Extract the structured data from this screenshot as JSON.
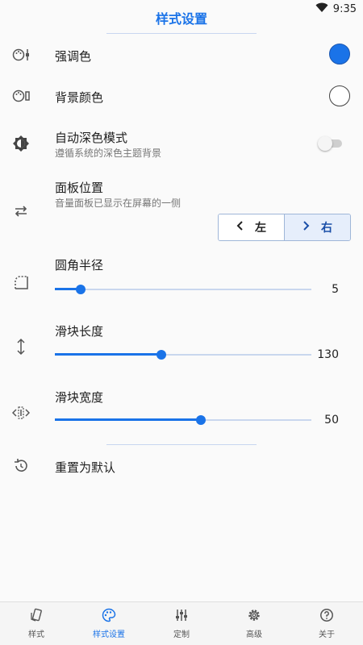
{
  "status_bar": {
    "time": "9:35"
  },
  "header": {
    "title": "样式设置"
  },
  "settings": {
    "accent_color": {
      "title": "强调色",
      "color": "#1a73e8"
    },
    "background_color": {
      "title": "背景颜色",
      "color": "#ffffff"
    },
    "auto_dark": {
      "title": "自动深色模式",
      "subtitle": "遵循系统的深色主题背景",
      "enabled": false
    },
    "panel_position": {
      "title": "面板位置",
      "subtitle": "音量面板已显示在屏幕的一侧",
      "options": [
        "左",
        "右"
      ],
      "selected": "右"
    },
    "corner_radius": {
      "title": "圆角半径",
      "value": "5",
      "fraction": 0.1
    },
    "slider_length": {
      "title": "滑块长度",
      "value": "130",
      "fraction": 0.415
    },
    "slider_width": {
      "title": "滑块宽度",
      "value": "50",
      "fraction": 0.57
    },
    "reset": {
      "title": "重置为默认"
    }
  },
  "bottom_nav": {
    "items": [
      {
        "label": "样式",
        "icon": "phone-style-icon"
      },
      {
        "label": "样式设置",
        "icon": "palette-icon"
      },
      {
        "label": "定制",
        "icon": "sliders-icon"
      },
      {
        "label": "高级",
        "icon": "gear-icon"
      },
      {
        "label": "关于",
        "icon": "help-icon"
      }
    ],
    "active_index": 1
  },
  "colors": {
    "accent": "#1a73e8"
  }
}
